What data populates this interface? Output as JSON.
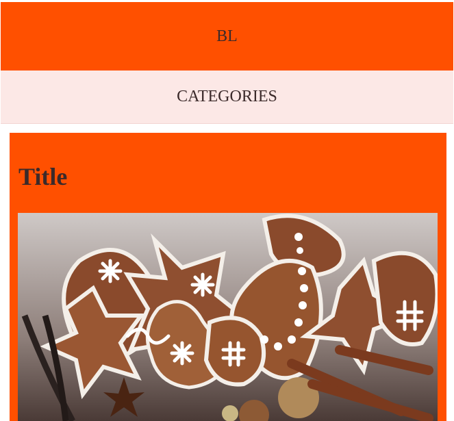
{
  "header": {
    "logo_text": "BL"
  },
  "nav": {
    "categories_label": "CATEGORIES"
  },
  "card": {
    "title": "Title",
    "image_icon": "gingerbread-cookies-photo"
  },
  "colors": {
    "accent": "#ff5000",
    "nav_bg": "#fce8e6",
    "text": "#3b2a2a"
  }
}
